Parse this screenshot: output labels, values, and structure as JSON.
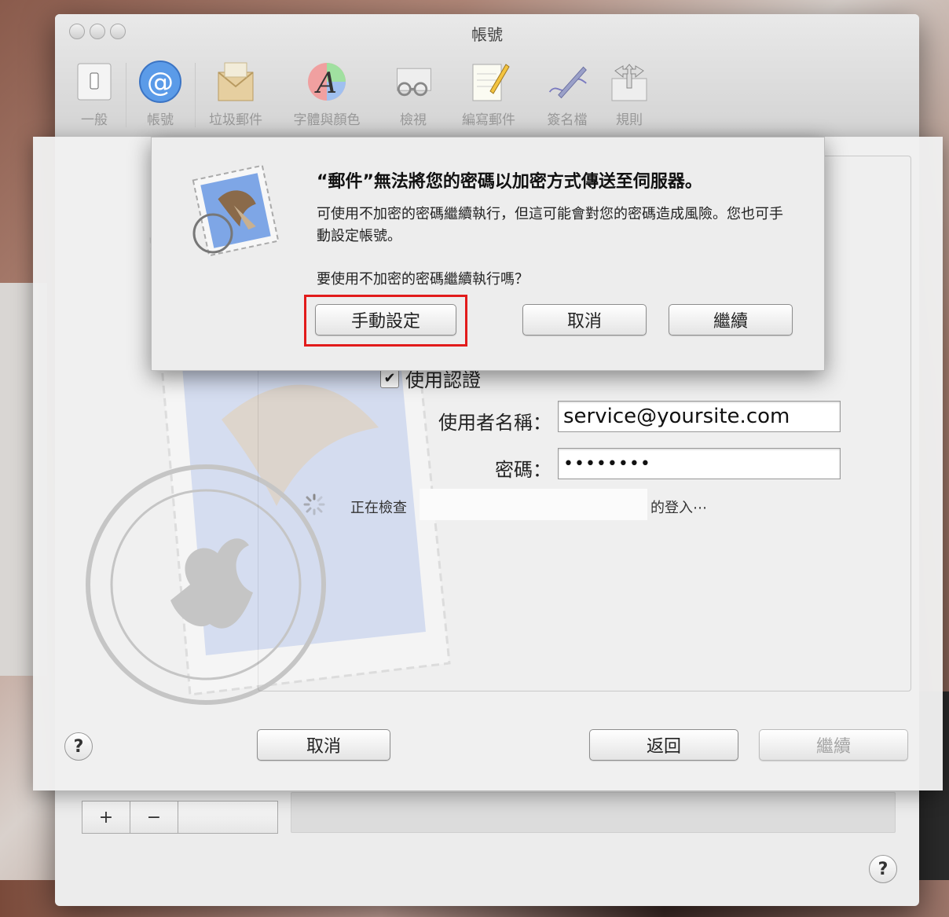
{
  "window": {
    "title": "帳號",
    "toolbar": [
      {
        "label": "一般",
        "icon": "switch-icon"
      },
      {
        "label": "帳號",
        "icon": "at-sign-icon",
        "selected": true
      },
      {
        "label": "垃圾郵件",
        "icon": "junk-mail-icon"
      },
      {
        "label": "字體與顏色",
        "icon": "font-color-icon"
      },
      {
        "label": "檢視",
        "icon": "glasses-icon"
      },
      {
        "label": "編寫郵件",
        "icon": "compose-icon"
      },
      {
        "label": "簽名檔",
        "icon": "signature-pen-icon"
      },
      {
        "label": "規則",
        "icon": "rules-arrows-icon"
      }
    ]
  },
  "sheet": {
    "use_auth_label": "使用認證",
    "use_auth_checked": true,
    "username_label": "使用者名稱：",
    "username_value": "service@yoursite.com",
    "password_label": "密碼：",
    "password_value": "••••••••",
    "status_prefix": "正在檢查",
    "status_suffix": "的登入⋯",
    "cancel_button": "取消",
    "back_button": "返回",
    "continue_button": "繼續",
    "help_symbol": "?"
  },
  "alert": {
    "title": "“郵件”無法將您的密碼以加密方式傳送至伺服器。",
    "body": "可使用不加密的密碼繼續執行，但這可能會對您的密碼造成風險。您也可手動設定帳號。",
    "question": "要使用不加密的密碼繼續執行嗎？",
    "manual_button": "手動設定",
    "cancel_button": "取消",
    "continue_button": "繼續"
  },
  "footer": {
    "add_symbol": "+",
    "remove_symbol": "−",
    "help_symbol": "?"
  },
  "colors": {
    "highlight": "#e21b1b",
    "selected_icon": "#4a8de0"
  }
}
